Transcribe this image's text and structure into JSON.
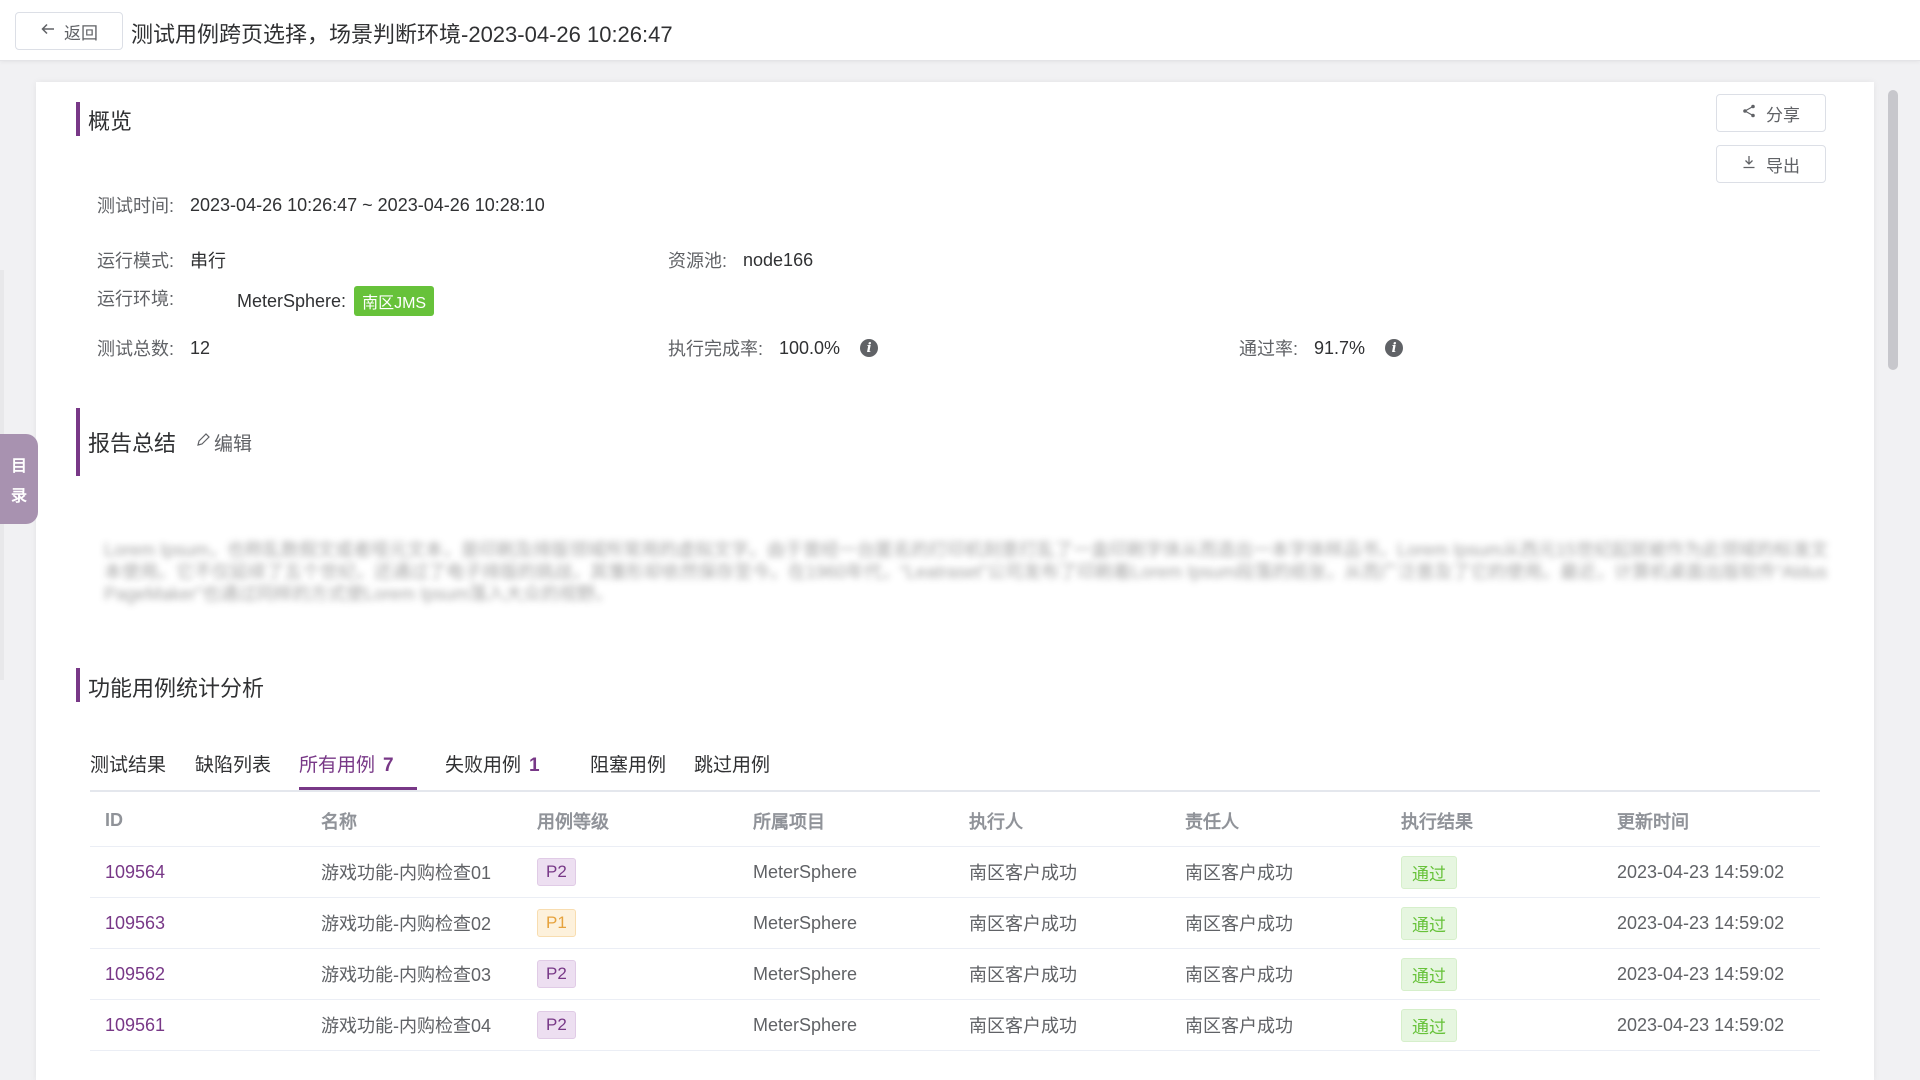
{
  "header": {
    "back_label": "返回",
    "title": "测试用例跨页选择，场景判断环境-2023-04-26 10:26:47"
  },
  "toc": {
    "chars": [
      "目",
      "录"
    ]
  },
  "overview": {
    "title": "概览",
    "share_label": "分享",
    "export_label": "导出",
    "test_time_label": "测试时间:",
    "test_time_value": "2023-04-26 10:26:47 ~ 2023-04-26 10:28:10",
    "run_mode_label": "运行模式:",
    "run_mode_value": "串行",
    "resource_pool_label": "资源池:",
    "resource_pool_value": "node166",
    "run_env_label": "运行环境:",
    "env_project": "MeterSphere:",
    "env_tag": "南区JMS",
    "total_label": "测试总数:",
    "total_value": "12",
    "exec_rate_label": "执行完成率:",
    "exec_rate_value": "100.0%",
    "pass_rate_label": "通过率:",
    "pass_rate_value": "91.7%",
    "info_glyph": "i"
  },
  "summary": {
    "title": "报告总结",
    "edit_label": "编辑",
    "text": "Lorem Ipsum，也称乱数假文或者哑元文本，是印刷及排版领域所常用的虚拟文字。由于曾经一台匿名的打印机刻意打乱了一盒印刷字体从而造出一本字体样品书，Lorem Ipsum从西元15世纪起就被作为此领域的标准文本使用。它不仅延续了五个世纪，还通过了电子排版的挑战，其雏形却依然保存至今。在1960年代，“Leatraset”公司发布了印刷着Lorem Ipsum段落的纸张，从而广泛普及了它的使用。最近，计算机桌面出版软件“Aldus PageMaker”也通过同样的方式使Lorem Ipsum落入大众的视野。"
  },
  "analysis": {
    "title": "功能用例统计分析",
    "tabs": [
      {
        "label": "测试结果",
        "count": ""
      },
      {
        "label": "缺陷列表",
        "count": ""
      },
      {
        "label": "所有用例",
        "count": "7"
      },
      {
        "label": "失败用例",
        "count": "1"
      },
      {
        "label": "阻塞用例",
        "count": ""
      },
      {
        "label": "跳过用例",
        "count": ""
      }
    ],
    "active_tab": 2
  },
  "table": {
    "columns": [
      "ID",
      "名称",
      "用例等级",
      "所属项目",
      "执行人",
      "责任人",
      "执行结果",
      "更新时间"
    ],
    "rows": [
      {
        "id": "109564",
        "name": "游戏功能-内购检查01",
        "level": "P2",
        "project": "MeterSphere",
        "executor": "南区客户成功",
        "maintainer": "南区客户成功",
        "result": "通过",
        "updated": "2023-04-23 14:59:02"
      },
      {
        "id": "109563",
        "name": "游戏功能-内购检查02",
        "level": "P1",
        "project": "MeterSphere",
        "executor": "南区客户成功",
        "maintainer": "南区客户成功",
        "result": "通过",
        "updated": "2023-04-23 14:59:02"
      },
      {
        "id": "109562",
        "name": "游戏功能-内购检查03",
        "level": "P2",
        "project": "MeterSphere",
        "executor": "南区客户成功",
        "maintainer": "南区客户成功",
        "result": "通过",
        "updated": "2023-04-23 14:59:02"
      },
      {
        "id": "109561",
        "name": "游戏功能-内购检查04",
        "level": "P2",
        "project": "MeterSphere",
        "executor": "南区客户成功",
        "maintainer": "南区客户成功",
        "result": "通过",
        "updated": "2023-04-23 14:59:02"
      }
    ]
  },
  "colors": {
    "accent": "#783887",
    "success": "#67c23a",
    "warning": "#e6a23c"
  }
}
